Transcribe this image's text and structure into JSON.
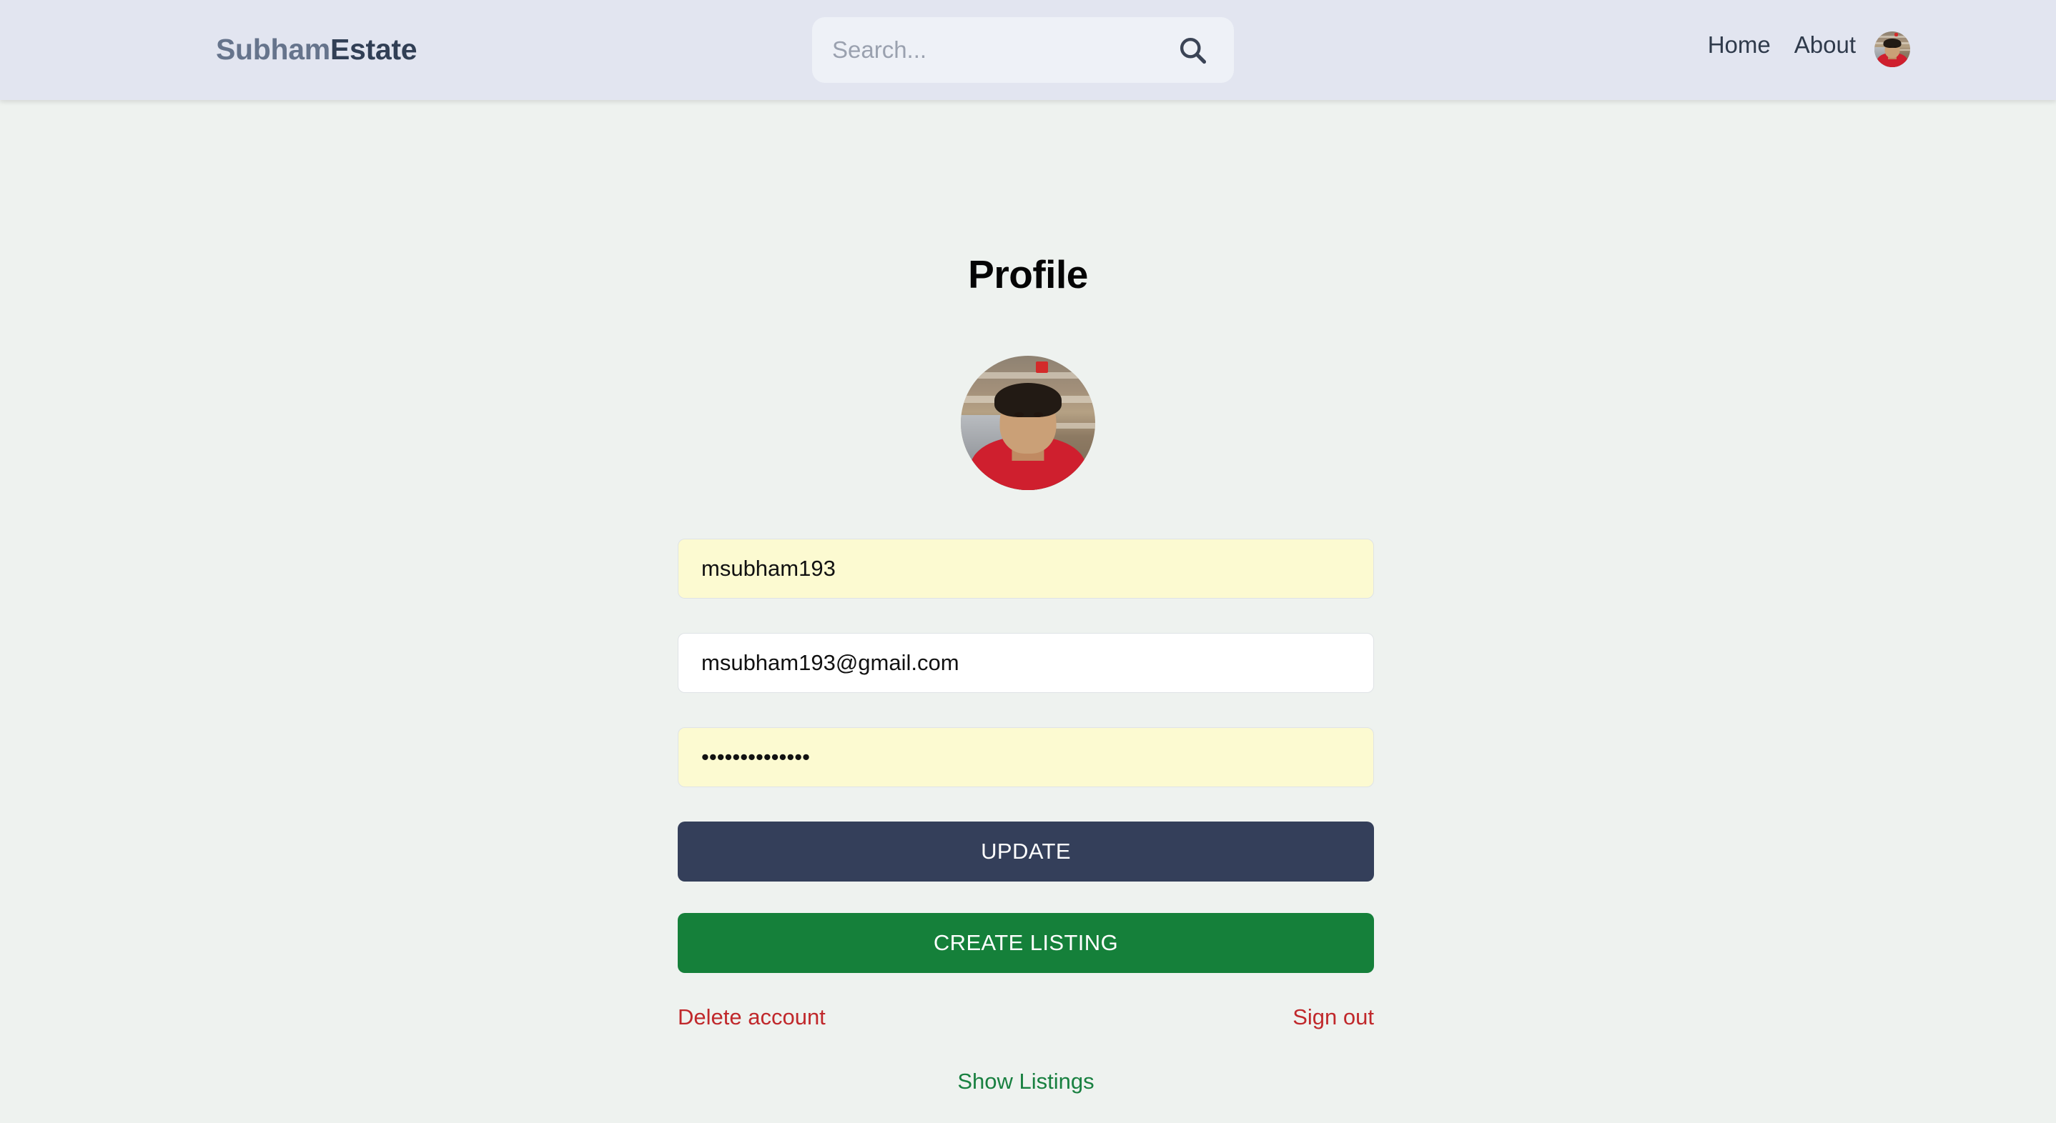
{
  "header": {
    "brand": {
      "first": "Subham",
      "second": "Estate"
    },
    "search": {
      "value": "",
      "placeholder": "Search...",
      "icon": "search-icon"
    },
    "nav": [
      {
        "label": "Home"
      },
      {
        "label": "About"
      }
    ],
    "avatar_alt": "User avatar",
    "background": "#e2e5f0"
  },
  "main": {
    "title": "Profile",
    "avatar_alt": "Profile picture",
    "fields": [
      {
        "name": "username",
        "value": "msubham193",
        "placeholder": "username",
        "autofilled": true
      },
      {
        "name": "email",
        "value": "msubham193@gmail.com",
        "placeholder": "email",
        "autofilled": false
      },
      {
        "name": "password",
        "value": "••••••••••••••",
        "placeholder": "password",
        "autofilled": true
      }
    ],
    "buttons": {
      "update": "Update",
      "create_listing": "Create Listing"
    },
    "links": {
      "delete_account": "Delete account",
      "sign_out": "Sign out",
      "show_listings": "Show Listings"
    },
    "colors": {
      "page_background": "#eef2ef",
      "update_button": "#343f5a",
      "create_button": "#15803a",
      "danger": "#c0282b",
      "success": "#188040",
      "autofill": "#fcfad1"
    }
  }
}
